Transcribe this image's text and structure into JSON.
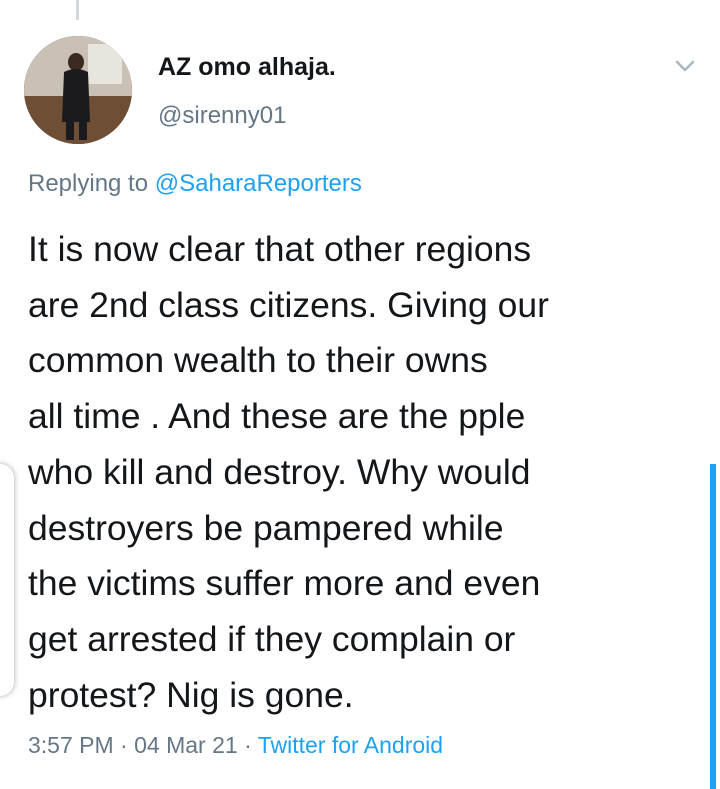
{
  "tweet": {
    "display_name": "AZ omo alhaja.",
    "handle": "@sirenny01",
    "replying_prefix": "Replying to",
    "replying_to": "@SaharaReporters",
    "body_lines": [
      "It is now clear that other regions",
      "are 2nd class citizens. Giving our",
      "common wealth to their owns",
      "all time . And these are the pple",
      "who kill and destroy. Why would",
      "destroyers be pampered while",
      "the victims suffer more and even",
      "get arrested if they complain or",
      "protest? Nig is gone."
    ],
    "time": "3:57 PM",
    "date": "04 Mar 21",
    "source": "Twitter for Android"
  },
  "icons": {
    "menu": "chevron-down-icon",
    "avatar": "avatar"
  },
  "colors": {
    "accent": "#1da1f2",
    "secondary_text": "#657786",
    "primary_text": "#14171a"
  }
}
